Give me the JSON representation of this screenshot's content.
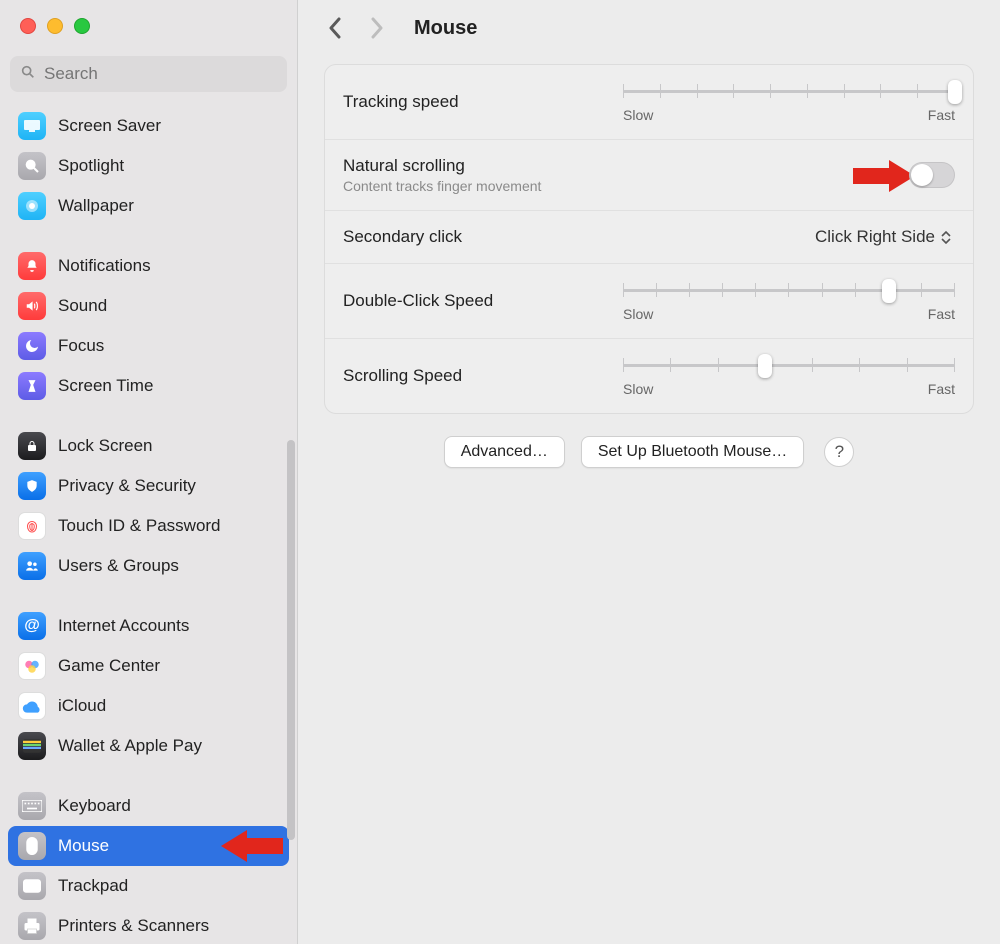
{
  "search": {
    "placeholder": "Search"
  },
  "title": "Mouse",
  "sidebar": {
    "items": [
      {
        "label": "Screen Saver"
      },
      {
        "label": "Spotlight"
      },
      {
        "label": "Wallpaper"
      },
      {
        "label": "Notifications"
      },
      {
        "label": "Sound"
      },
      {
        "label": "Focus"
      },
      {
        "label": "Screen Time"
      },
      {
        "label": "Lock Screen"
      },
      {
        "label": "Privacy & Security"
      },
      {
        "label": "Touch ID & Password"
      },
      {
        "label": "Users & Groups"
      },
      {
        "label": "Internet Accounts"
      },
      {
        "label": "Game Center"
      },
      {
        "label": "iCloud"
      },
      {
        "label": "Wallet & Apple Pay"
      },
      {
        "label": "Keyboard"
      },
      {
        "label": "Mouse"
      },
      {
        "label": "Trackpad"
      },
      {
        "label": "Printers & Scanners"
      }
    ]
  },
  "rows": {
    "tracking": {
      "label": "Tracking speed",
      "slow": "Slow",
      "fast": "Fast",
      "ticks": 10,
      "value_index": 9
    },
    "natural": {
      "label": "Natural scrolling",
      "sub": "Content tracks finger movement",
      "enabled": false
    },
    "secondary": {
      "label": "Secondary click",
      "value": "Click Right Side"
    },
    "double": {
      "label": "Double-Click Speed",
      "slow": "Slow",
      "fast": "Fast",
      "ticks": 11,
      "value_index": 8
    },
    "scrolling": {
      "label": "Scrolling Speed",
      "slow": "Slow",
      "fast": "Fast",
      "ticks": 8,
      "value_index": 3
    }
  },
  "buttons": {
    "advanced": "Advanced…",
    "bluetooth": "Set Up Bluetooth Mouse…",
    "help": "?"
  }
}
